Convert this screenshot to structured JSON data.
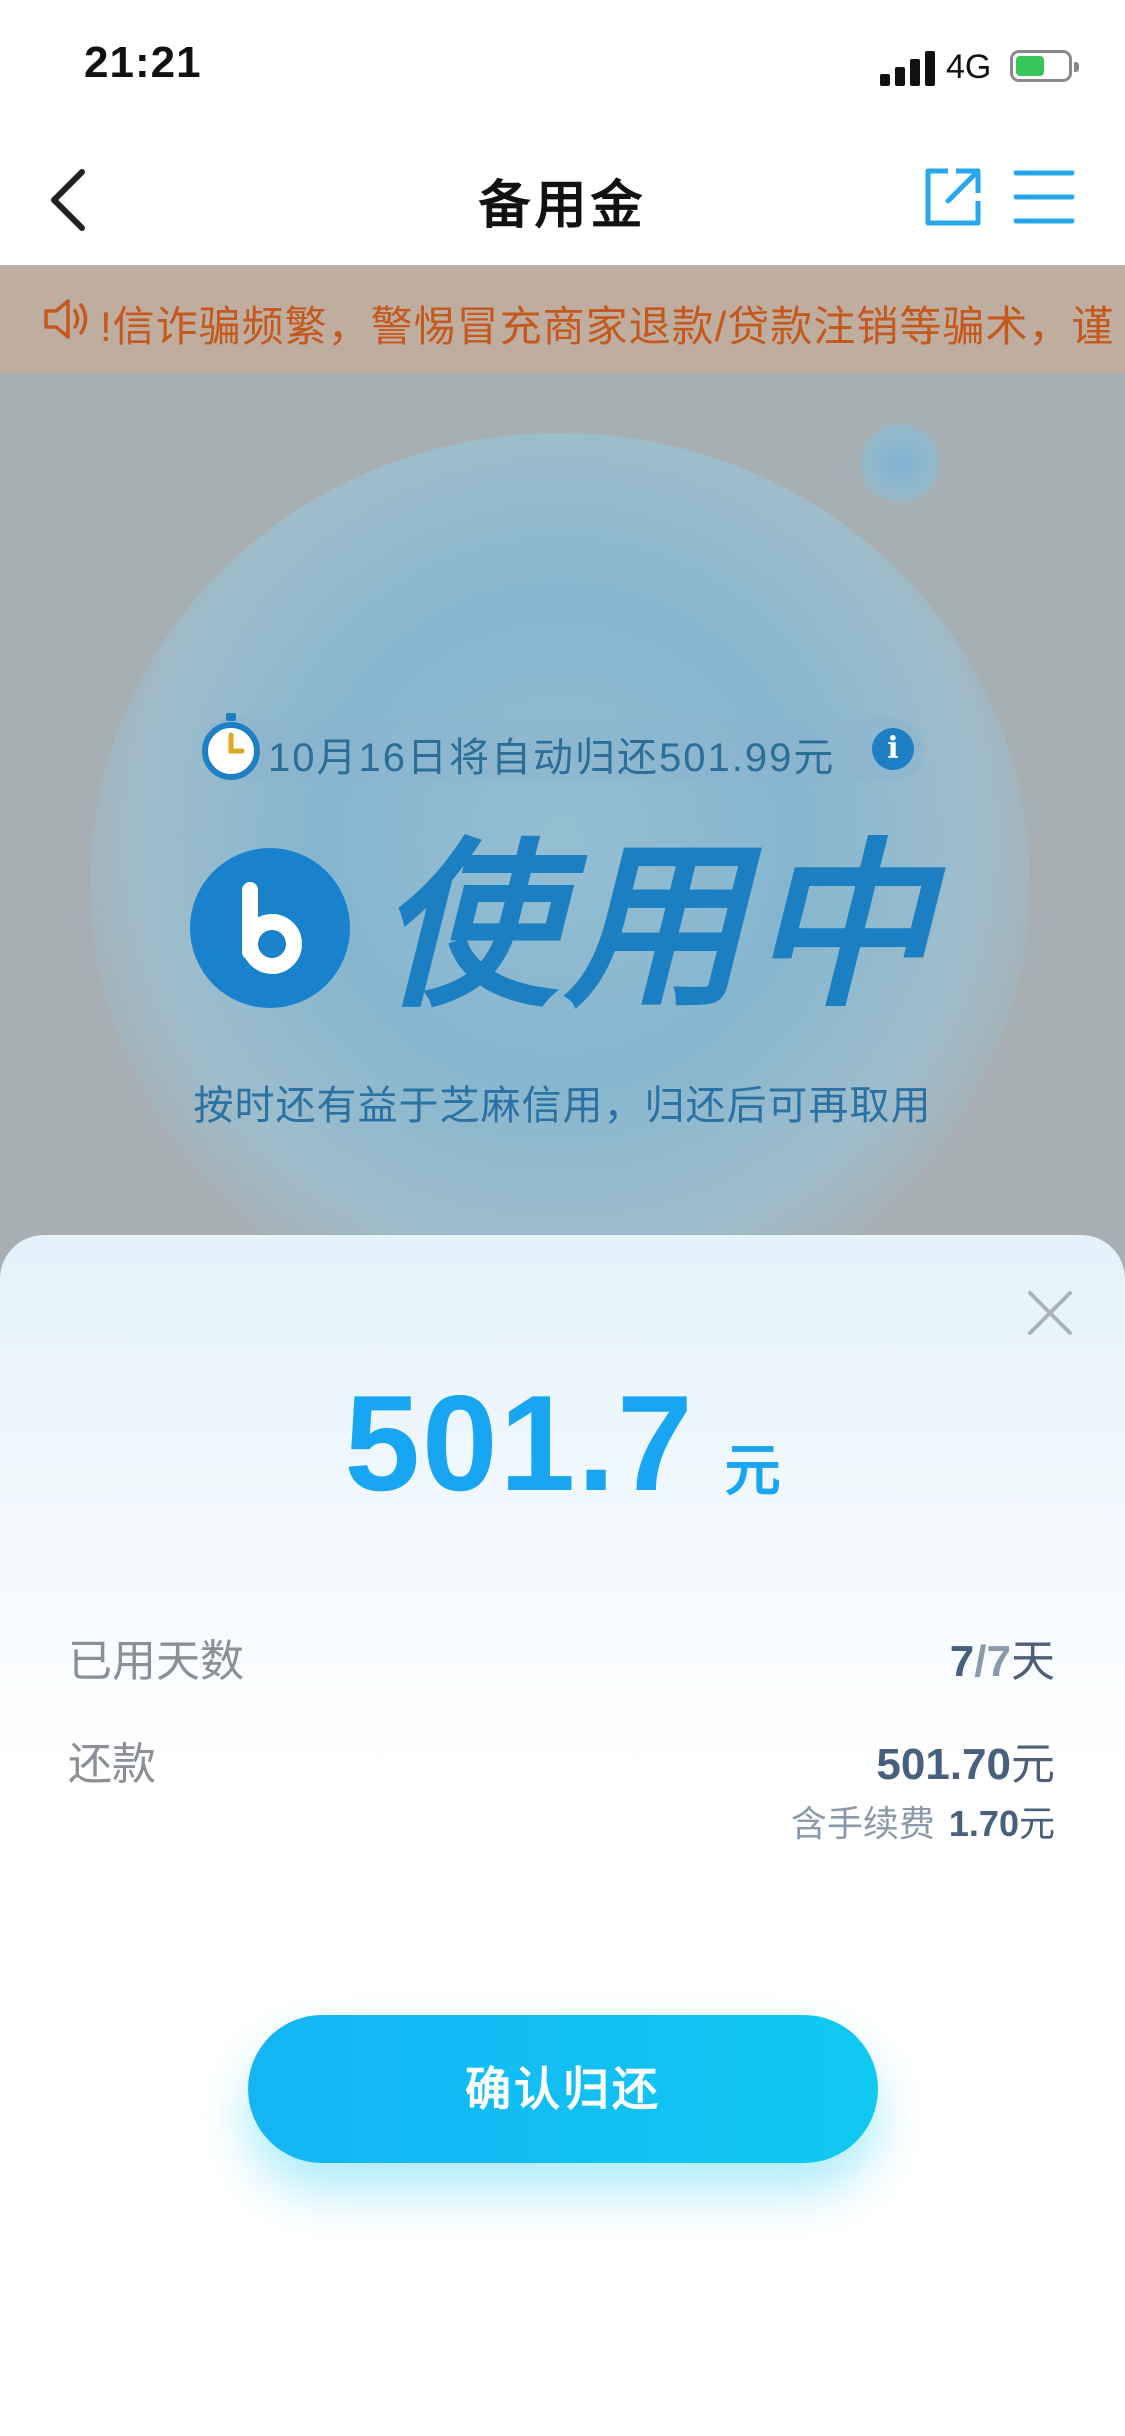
{
  "status_bar": {
    "time": "21:21",
    "network": "4G"
  },
  "nav": {
    "title": "备用金",
    "back_icon": "chevron-left-icon",
    "share_icon": "share-external-icon",
    "menu_icon": "menu-icon"
  },
  "notice": {
    "text": "!信诈骗频繁，警惕冒充商家退款/贷款注销等骗术，谨"
  },
  "hero": {
    "due_text": "10月16日将自动归还501.99元",
    "info_glyph": "i",
    "status": "使用中",
    "credit_tip": "按时还有益于芝麻信用，归还后可再取用"
  },
  "sheet": {
    "amount": "501.7",
    "amount_unit": "元",
    "days_label": "已用天数",
    "days_used": "7",
    "days_sep": "/",
    "days_total": "7",
    "days_unit": "天",
    "repay_label": "还款",
    "repay_value": "501.70",
    "repay_unit": "元",
    "fee_label": "含手续费",
    "fee_value": "1.70",
    "fee_unit": "元",
    "confirm_label": "确认归还"
  },
  "colors": {
    "accent": "#18a5f2",
    "button": "#14b4f5",
    "notice_text": "#c4581d"
  }
}
